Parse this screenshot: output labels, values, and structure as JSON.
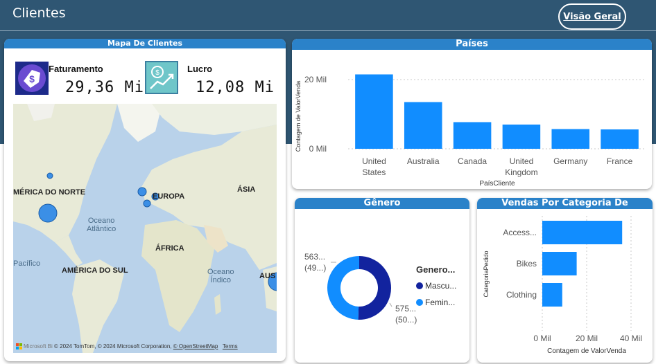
{
  "header": {
    "title": "Clientes",
    "nav_button": "Visão Geral"
  },
  "map_card": {
    "title": "Mapa De Clientes",
    "kpis": [
      {
        "label": "Faturamento",
        "value": "29,36 Mi",
        "icon": "price-tag-icon"
      },
      {
        "label": "Lucro",
        "value": "12,08 Mi",
        "icon": "money-growth-icon"
      }
    ],
    "labels": {
      "north_america": "MÉRICA DO NORTE",
      "europe": "EUROPA",
      "asia": "ÁSIA",
      "africa": "ÁFRICA",
      "south_america": "AMÉRICA DO SUL",
      "atlantic": "Oceano\nAtlântico",
      "pacific": "Pacífico",
      "indian": "Oceano\nÍndico",
      "australia": "AUS"
    },
    "attribution": {
      "brand": "Microsoft Bi",
      "text": "© 2024 TomTom, © 2024 Microsoft Corporation,",
      "osm": "© OpenStreetMap",
      "terms": "Terms"
    }
  },
  "paises_card": {
    "title": "Países"
  },
  "genero_card": {
    "title": "Gênero"
  },
  "vendas_card": {
    "title": "Vendas Por Categoria De Produtos"
  },
  "colors": {
    "header_band": "#2f5673",
    "card_header": "#2b82c9",
    "bar": "#118dff",
    "donut_dark": "#12239e",
    "donut_light": "#118dff"
  },
  "chart_data": [
    {
      "type": "bar",
      "title": "Países",
      "xlabel": "PaísCliente",
      "ylabel": "Contagem de ValorVenda",
      "categories": [
        "United States",
        "Australia",
        "Canada",
        "United Kingdom",
        "Germany",
        "France"
      ],
      "category_lines": [
        [
          "United",
          "States"
        ],
        [
          "Australia"
        ],
        [
          "Canada"
        ],
        [
          "United",
          "Kingdom"
        ],
        [
          "Germany"
        ],
        [
          "France"
        ]
      ],
      "values": [
        21500,
        13500,
        7700,
        7000,
        5700,
        5600
      ],
      "ylim": [
        0,
        25000
      ],
      "yticks": [
        0,
        20000
      ],
      "yticklabels": [
        "0 Mil",
        "20 Mil"
      ],
      "grid": true
    },
    {
      "type": "pie",
      "title": "Gênero",
      "legend_title": "Genero...",
      "slices": [
        {
          "name": "Mascu...",
          "value": 50.5,
          "label_lines": [
            "575...",
            "(50...)"
          ]
        },
        {
          "name": "Femin...",
          "value": 49.5,
          "label_lines": [
            "563...",
            "(49...)"
          ]
        }
      ],
      "legend": "right"
    },
    {
      "type": "bar",
      "orientation": "horizontal",
      "title": "Vendas Por Categoria De Produtos",
      "xlabel": "Contagem de ValorVenda",
      "ylabel": "CategoriaPedido",
      "categories": [
        "Access...",
        "Bikes",
        "Clothing"
      ],
      "values": [
        36000,
        15500,
        9000
      ],
      "xlim": [
        0,
        40000
      ],
      "xticks": [
        0,
        20000,
        40000
      ],
      "xticklabels": [
        "0 Mil",
        "20 Mil",
        "40 Mil"
      ],
      "grid": true
    }
  ]
}
